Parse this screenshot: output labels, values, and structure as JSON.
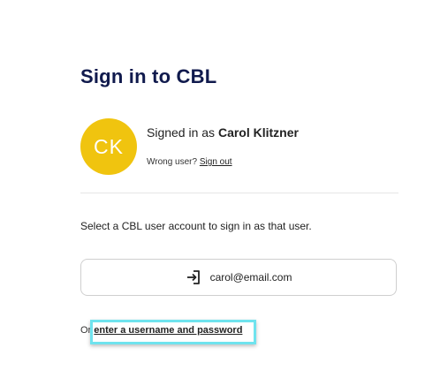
{
  "header": {
    "title": "Sign in to CBL"
  },
  "current_user": {
    "initials": "CK",
    "avatar_color": "#f0c40f",
    "signed_in_prefix": "Signed in as",
    "name": "Carol Klitzner",
    "wrong_user_prompt": "Wrong user?",
    "sign_out_label": "Sign out"
  },
  "accounts": {
    "instruction": "Select a CBL user account to sign in as that user.",
    "items": [
      {
        "email": "carol@email.com",
        "icon": "sign-in-icon"
      }
    ]
  },
  "alternate": {
    "prefix": "Or",
    "link_label": "enter a username and password",
    "highlight_color": "#6fe3ee"
  },
  "colors": {
    "title": "#101a4d"
  }
}
